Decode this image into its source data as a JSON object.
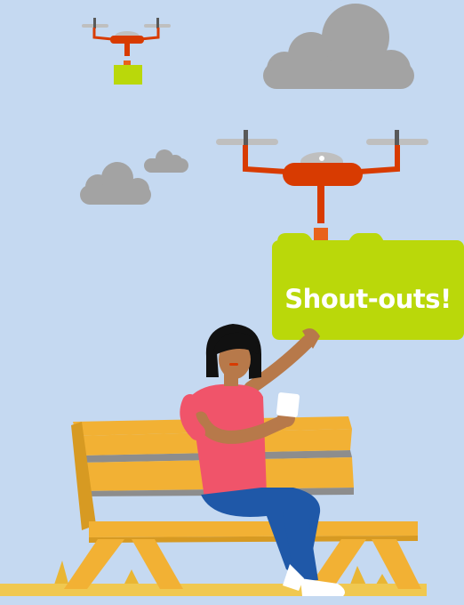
{
  "illustration": {
    "sign_text": "Shout-outs!",
    "icons": [
      "cloud-icon",
      "drone-icon",
      "package-icon",
      "bench-icon",
      "person-icon",
      "phone-icon",
      "grass-icon"
    ]
  },
  "colors": {
    "sky": "#c5d9f1",
    "cloud": "#a3a3a3",
    "drone_body": "#d83b01",
    "propeller": "#bfbfbf",
    "package_green": "#bad80a",
    "bench": "#f2b134",
    "bench_shadow": "#d79a22",
    "shirt": "#f0546a",
    "jeans": "#1f58a8",
    "skin": "#b7794a",
    "hair": "#111111",
    "grass": "#e9b634"
  }
}
